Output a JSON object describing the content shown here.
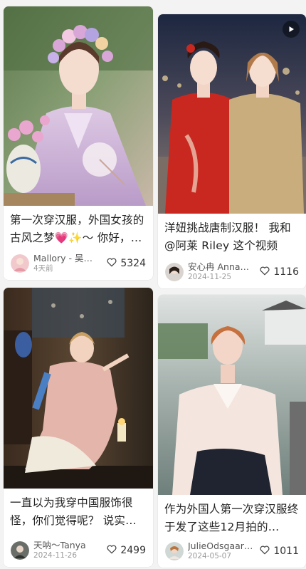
{
  "feed": {
    "cards": [
      {
        "title": "第一次穿汉服，外国女孩的古风之梦💗✨～ 你好，…",
        "author": "Mallory - 吴…",
        "date": "4天前",
        "likes": "5324",
        "icon": "heart-outline-icon",
        "has_video": false
      },
      {
        "title": "洋妞挑战唐制汉服！ 我和@阿莱 Riley 这个视频发…",
        "author": "安心冉 Anna…",
        "date": "2024-11-25",
        "likes": "1116",
        "icon": "heart-outline-icon",
        "has_video": true,
        "video_icon": "play-icon"
      },
      {
        "title": "一直以为我穿中国服饰很怪，你们觉得呢？ 说实…",
        "author": "天呐～Tanya",
        "date": "2024-11-26",
        "likes": "2499",
        "icon": "heart-outline-icon",
        "has_video": false
      },
      {
        "title": "作为外国人第一次穿汉服终于发了这些12月拍的…",
        "author": "JulieOdsgaar…",
        "date": "2024-05-07",
        "likes": "1011",
        "icon": "heart-outline-icon",
        "has_video": false
      }
    ]
  },
  "colors": {
    "background": "#f3f3f3",
    "card": "#ffffff",
    "text": "#222222",
    "meta": "#9a9a9a"
  }
}
